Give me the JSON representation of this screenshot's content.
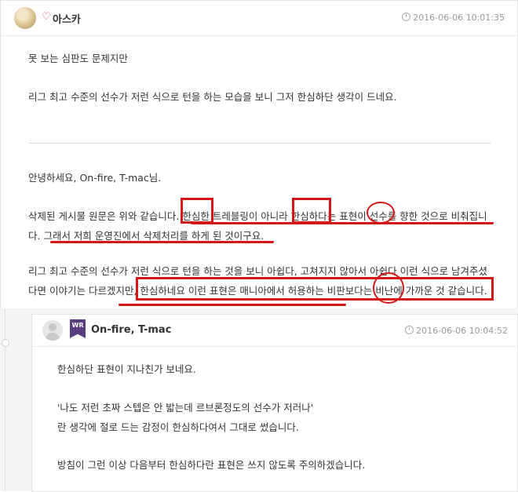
{
  "post": {
    "author": "아스카",
    "timestamp": "2016-06-06 10:01:35",
    "quote_lines": [
      "못 보는 심판도 문제지만",
      "리그 최고 수준의 선수가 저런 식으로 턴을 하는 모습을 보니 그저 한심하단 생각이 드네요."
    ],
    "body_lines": [
      "안녕하세요, On-fire, T-mac님.",
      "삭제된 게시물 원문은 위와 같습니다. 한심한 트레블링이 아니라 한심하다는 표현이 선수를 향한 것으로 비춰집니",
      "다. 그래서 저희 운영진에서 삭제처리를 하게 된 것이구요.",
      "리그 최고 수준의 선수가 저런 식으로 턴을 하는 것을 보니 아쉽다, 고쳐지지 않아서 아쉽다 이런 식으로 남겨주셨",
      "다면 이야기는 다르겠지만, 한심하네요 이런 표현은 매니아에서 허용하는 비판보다는 비난에 가까운 것 같습니다."
    ]
  },
  "reply": {
    "badge": "WR",
    "author": "On-fire, T-mac",
    "timestamp": "2016-06-06 10:04:52",
    "lines": [
      "한심하단 표현이 지나친가 보네요.",
      "'나도 저런 초짜 스텝은 안 밟는데 르브론정도의 선수가 저러나'",
      "란 생각에 절로 드는 감정이 한심하다여서 그대로 썼습니다.",
      "방침이 그런 이상 다음부터 한심하다란 표현은 쓰지 않도록 주의하겠습니다."
    ]
  },
  "colors": {
    "annotation": "#d41818",
    "badge": "#5a3d7f",
    "heart": "#c63a6a"
  },
  "icons": [
    "heart-icon",
    "clock-icon",
    "avatar-default-icon"
  ]
}
